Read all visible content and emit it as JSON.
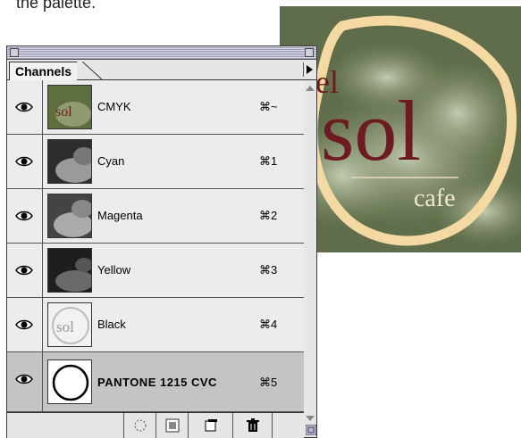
{
  "caption": "the palette.",
  "artwork": {
    "word_del": "del",
    "word_sol": "sol",
    "word_cafe": "cafe"
  },
  "palette": {
    "tab_label": "Channels",
    "channels": [
      {
        "name": "CMYK",
        "shortcut": "⌘~",
        "thumb": "cmyk-thumbnail-icon"
      },
      {
        "name": "Cyan",
        "shortcut": "⌘1",
        "thumb": "cyan-thumbnail-icon"
      },
      {
        "name": "Magenta",
        "shortcut": "⌘2",
        "thumb": "magenta-thumbnail-icon"
      },
      {
        "name": "Yellow",
        "shortcut": "⌘3",
        "thumb": "yellow-thumbnail-icon"
      },
      {
        "name": "Black",
        "shortcut": "⌘4",
        "thumb": "black-thumbnail-icon"
      },
      {
        "name": "PANTONE 1215 CVC",
        "shortcut": "⌘5",
        "thumb": "pantone-thumbnail-icon"
      }
    ],
    "selected_channel": "PANTONE 1215 CVC",
    "bottom_buttons": [
      "load-selection-icon",
      "save-selection-icon",
      "new-channel-icon",
      "trash-icon"
    ]
  },
  "colors": {
    "art_green": "#6b7a55",
    "art_maroon": "#6e1a22",
    "art_ring": "#f4d9a3",
    "palette_bg": "#e6e6e6",
    "row_selected": "#c4c4c4"
  }
}
